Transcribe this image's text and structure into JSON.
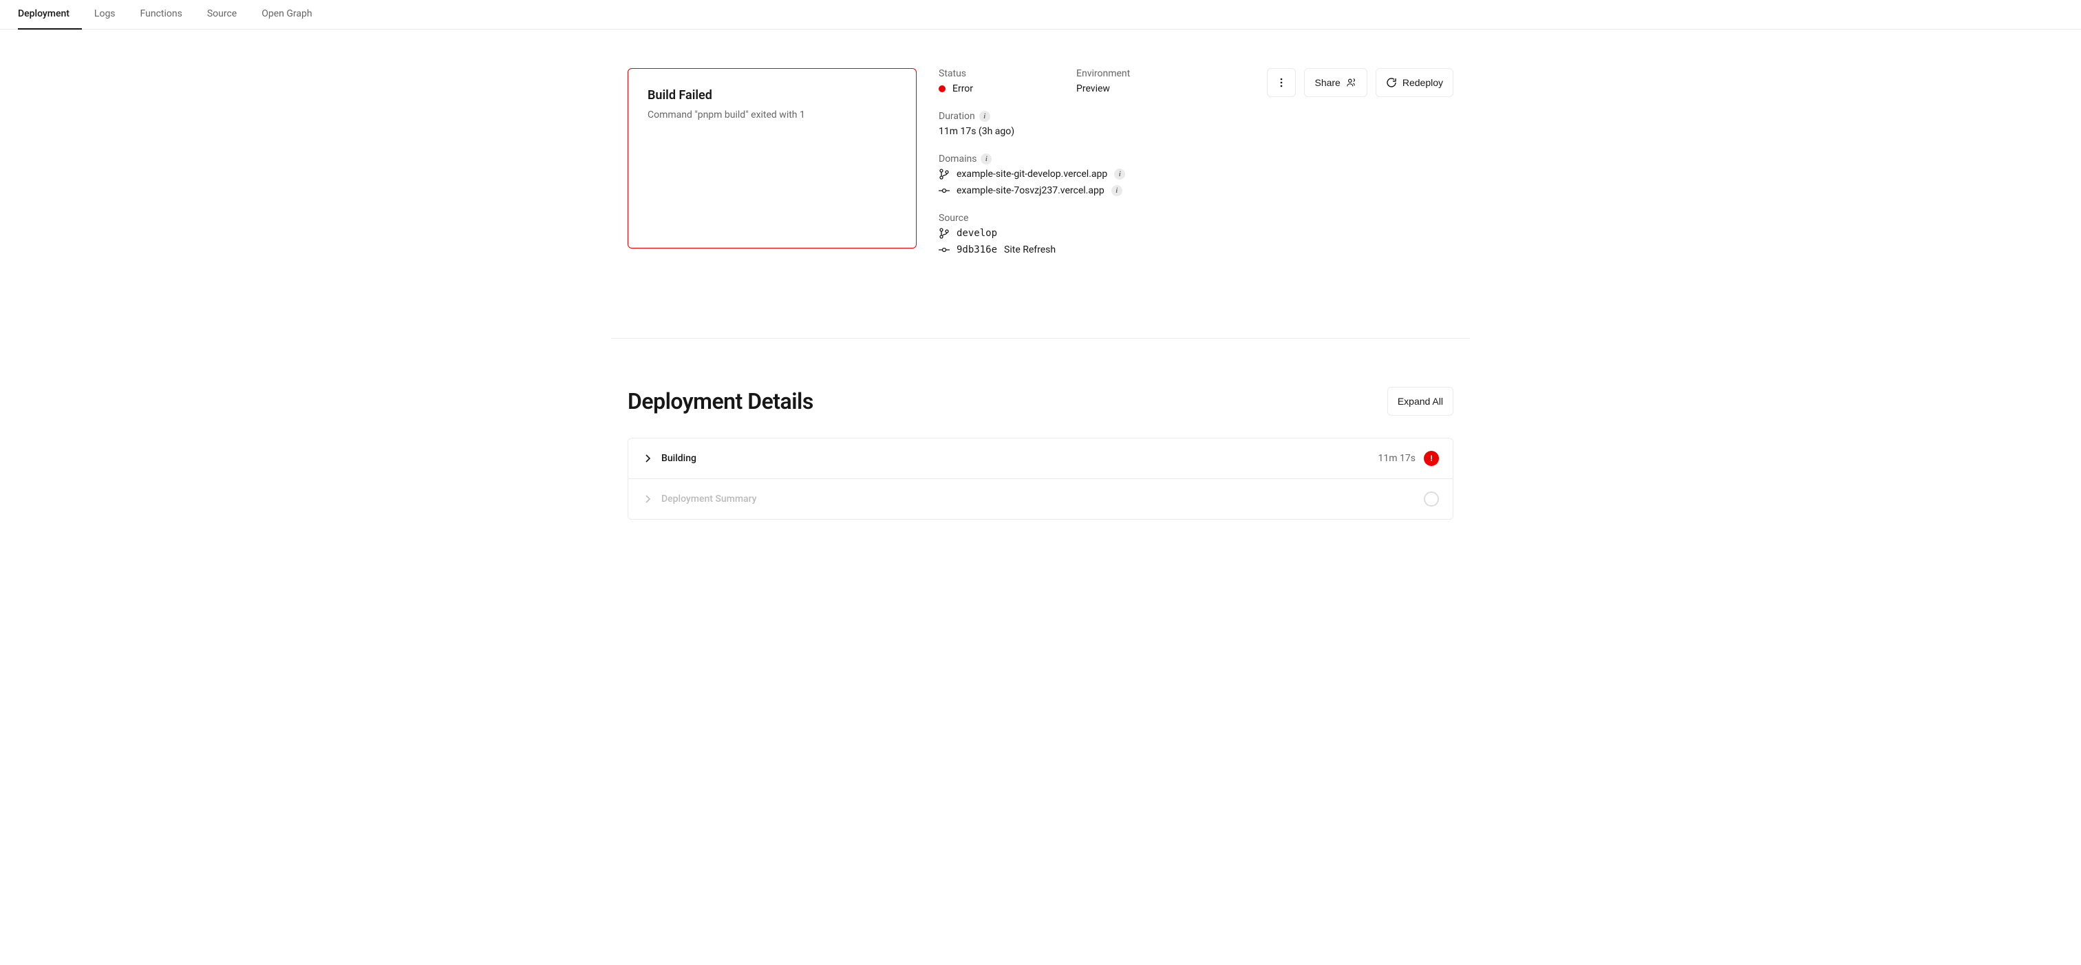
{
  "tabs": [
    {
      "label": "Deployment",
      "active": true
    },
    {
      "label": "Logs"
    },
    {
      "label": "Functions"
    },
    {
      "label": "Source"
    },
    {
      "label": "Open Graph"
    }
  ],
  "preview": {
    "title": "Build Failed",
    "message": "Command \"pnpm build\" exited with 1"
  },
  "status": {
    "label": "Status",
    "value": "Error"
  },
  "environment": {
    "label": "Environment",
    "value": "Preview"
  },
  "duration": {
    "label": "Duration",
    "value": "11m 17s (3h ago)"
  },
  "domains": {
    "label": "Domains",
    "items": [
      "example-site-git-develop.vercel.app",
      "example-site-7osvzj237.vercel.app"
    ]
  },
  "source": {
    "label": "Source",
    "branch": "develop",
    "commit_hash": "9db316e",
    "commit_msg": "Site Refresh"
  },
  "actions": {
    "share": "Share",
    "redeploy": "Redeploy"
  },
  "details": {
    "heading": "Deployment Details",
    "expand_all": "Expand All",
    "rows": [
      {
        "title": "Building",
        "time": "11m 17s",
        "error": true
      },
      {
        "title": "Deployment Summary",
        "disabled": true
      }
    ]
  }
}
